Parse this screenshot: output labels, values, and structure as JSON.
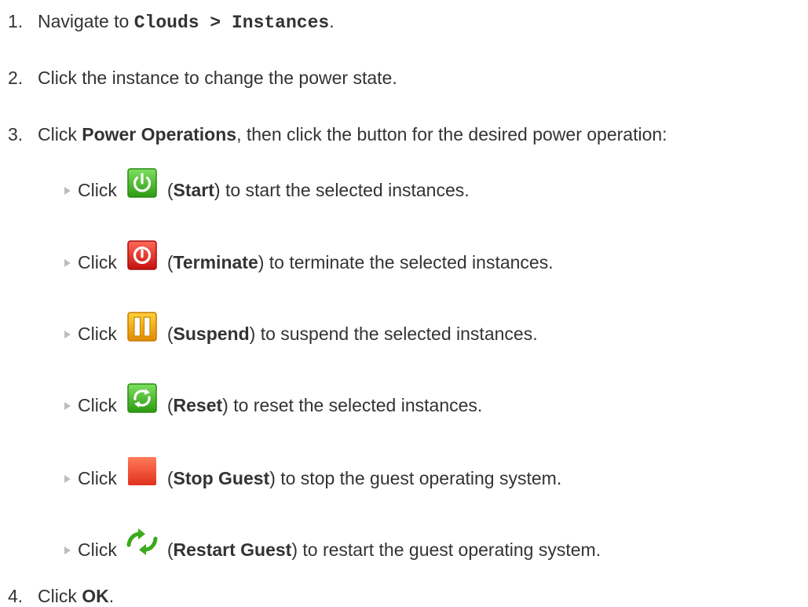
{
  "steps": {
    "s1": {
      "num": "1.",
      "pre": "Navigate to ",
      "code": "Clouds > Instances",
      "post": "."
    },
    "s2": {
      "num": "2.",
      "text": "Click the instance to change the power state."
    },
    "s3": {
      "num": "3.",
      "pre": "Click ",
      "bold": "Power Operations",
      "post": ", then click the button for the desired power operation:"
    },
    "s4": {
      "num": "4.",
      "pre": "Click ",
      "bold": "OK",
      "post": "."
    }
  },
  "operations": [
    {
      "click": "Click",
      "open": "(",
      "name": "Start",
      "desc": ") to start the selected instances.",
      "icon": "start-power-icon",
      "color": "#3fb618"
    },
    {
      "click": "Click",
      "open": "(",
      "name": "Terminate",
      "desc": ") to terminate the selected instances.",
      "icon": "terminate-power-icon",
      "color": "#e02020"
    },
    {
      "click": "Click",
      "open": "(",
      "name": "Suspend",
      "desc": ") to suspend the selected instances.",
      "icon": "suspend-pause-icon",
      "color": "#f0a800"
    },
    {
      "click": "Click",
      "open": "(",
      "name": "Reset",
      "desc": ") to reset the selected instances.",
      "icon": "reset-cycle-icon",
      "color": "#3fb618"
    },
    {
      "click": "Click",
      "open": "(",
      "name": "Stop Guest",
      "desc": ") to stop the guest operating system.",
      "icon": "stop-guest-icon",
      "color": "#e8402a"
    },
    {
      "click": "Click",
      "open": "(",
      "name": "Restart Guest",
      "desc": ") to restart the guest operating system.",
      "icon": "restart-guest-arrows-icon",
      "color": "#3fb618"
    }
  ]
}
